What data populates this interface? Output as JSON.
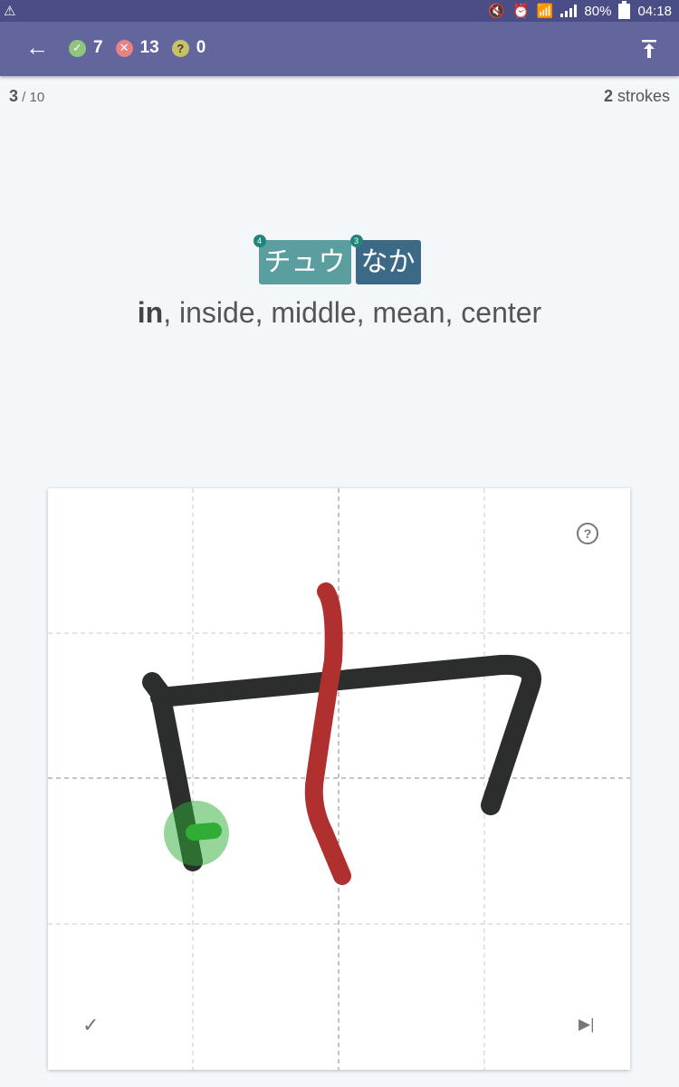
{
  "status_bar": {
    "battery": "80%",
    "time": "04:18"
  },
  "toolbar": {
    "correct_count": "7",
    "wrong_count": "13",
    "unknown_count": "0"
  },
  "progress": {
    "current": "3",
    "separator": " / ",
    "total": "10"
  },
  "strokes": {
    "count": "2",
    "label": " strokes"
  },
  "readings": [
    {
      "text": "チュウ",
      "badge": "4"
    },
    {
      "text": "なか",
      "badge": "3"
    }
  ],
  "meaning": {
    "primary": "in",
    "rest": ", inside, middle, mean, center"
  },
  "colors": {
    "status_bar": "#4b4d86",
    "app_bar": "#62669c",
    "on_reading": "#5b9ea0",
    "kun_reading": "#3c6a86",
    "stroke_drawn": "#2b2e2c",
    "stroke_current": "#b0302f",
    "hint": "#30ad36"
  }
}
